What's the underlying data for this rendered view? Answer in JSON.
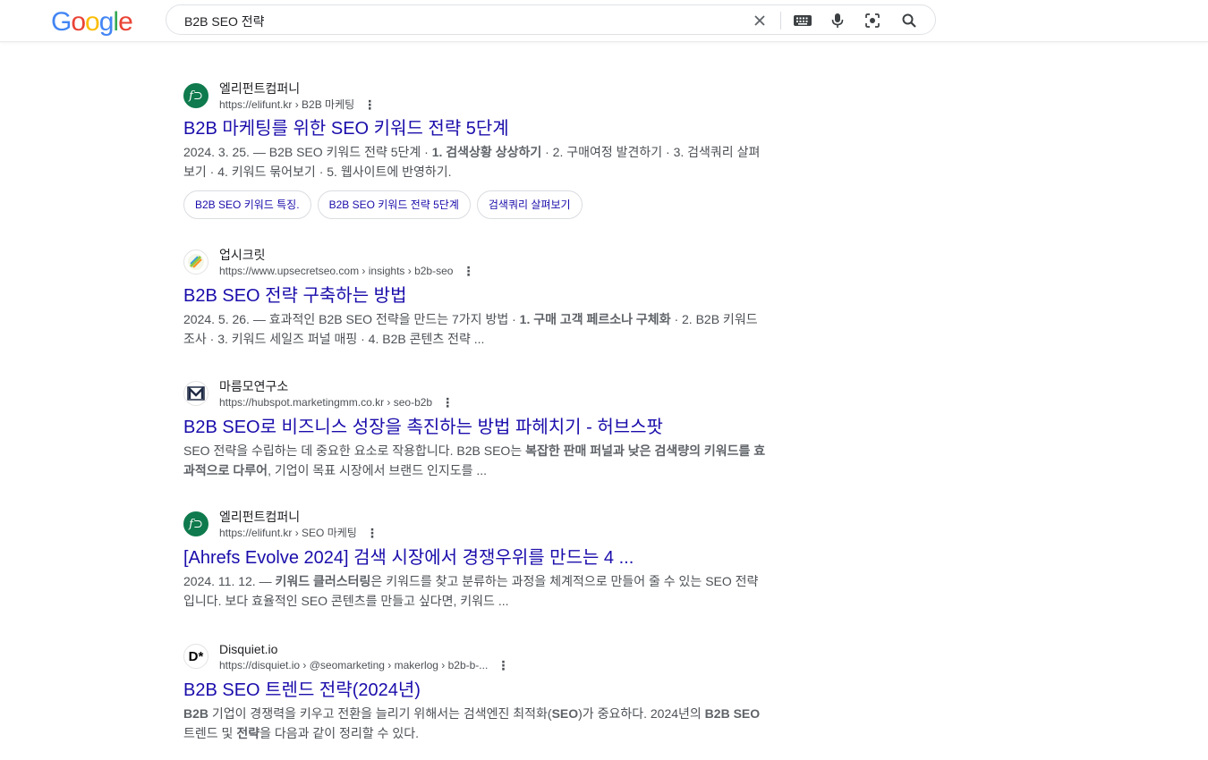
{
  "header": {
    "logo_letters": [
      "G",
      "o",
      "o",
      "g",
      "l",
      "e"
    ],
    "logo_colors": [
      "#4285F4",
      "#EA4335",
      "#FBBC05",
      "#4285F4",
      "#34A853",
      "#EA4335"
    ],
    "search_query": "B2B SEO 전략",
    "icons": [
      "close-icon",
      "keyboard-icon",
      "microphone-icon",
      "lens-icon",
      "search-icon"
    ]
  },
  "results": [
    {
      "site_name": "엘리펀트컴퍼니",
      "url": "https://elifunt.kr › B2B 마케팅",
      "favicon_text": "f⊃",
      "favicon_bg": "#0f7a4d",
      "title": "B2B 마케팅를 위한 SEO 키워드 전략 5단계",
      "snippet_parts": [
        {
          "t": "2024. 3. 25. — B2B SEO 키워드 전략 5단계 · ",
          "b": false
        },
        {
          "t": "1. 검색상황 상상하기",
          "b": true
        },
        {
          "t": " · 2. 구매여정 발견하기 · 3. 검색쿼리 살펴보기 · 4. 키워드 묶어보기 · 5. 웹사이트에 반영하기.",
          "b": false
        }
      ],
      "chips": [
        "B2B SEO 키워드 특징.",
        "B2B SEO 키워드 전략 5단계",
        "검색쿼리 살펴보기"
      ]
    },
    {
      "site_name": "업시크릿",
      "url": "https://www.upsecretseo.com › insights › b2b-seo",
      "favicon_text": "⟋",
      "favicon_bg": "#ffffff",
      "title": "B2B SEO 전략 구축하는 방법",
      "snippet_parts": [
        {
          "t": "2024. 5. 26. — 효과적인 B2B SEO 전략을 만드는 7가지 방법 · ",
          "b": false
        },
        {
          "t": "1. 구매 고객 페르소나 구체화",
          "b": true
        },
        {
          "t": " · 2. B2B 키워드 조사 · 3. 키워드 세일즈 퍼널 매핑 · 4. B2B 콘텐츠 전략 ...",
          "b": false
        }
      ],
      "chips": []
    },
    {
      "site_name": "마름모연구소",
      "url": "https://hubspot.marketingmm.co.kr › seo-b2b",
      "favicon_text": "M",
      "favicon_bg": "#ffffff",
      "title": "B2B SEO로 비즈니스 성장을 촉진하는 방법 파헤치기 - 허브스팟",
      "snippet_parts": [
        {
          "t": "SEO 전략을 수립하는 데 중요한 요소로 작용합니다. B2B SEO는 ",
          "b": false
        },
        {
          "t": "복잡한 판매 퍼널과 낮은 검색량의 키워드를 효과적으로 다루어",
          "b": true
        },
        {
          "t": ", 기업이 목표 시장에서 브랜드 인지도를 ...",
          "b": false
        }
      ],
      "chips": []
    },
    {
      "site_name": "엘리펀트컴퍼니",
      "url": "https://elifunt.kr › SEO 마케팅",
      "favicon_text": "f⊃",
      "favicon_bg": "#0f7a4d",
      "title": "[Ahrefs Evolve 2024] 검색 시장에서 경쟁우위를 만드는 4 ...",
      "snippet_parts": [
        {
          "t": "2024. 11. 12. — ",
          "b": false
        },
        {
          "t": "키워드 클러스터링",
          "b": true
        },
        {
          "t": "은 키워드를 찾고 분류하는 과정을 체계적으로 만들어 줄 수 있는 SEO 전략입니다. 보다 효율적인 SEO 콘텐츠를 만들고 싶다면, 키워드 ...",
          "b": false
        }
      ],
      "chips": []
    },
    {
      "site_name": "Disquiet.io",
      "url": "https://disquiet.io › @seomarketing › makerlog › b2b-b-...",
      "favicon_text": "D*",
      "favicon_bg": "#ffffff",
      "title": "B2B SEO 트렌드 전략(2024년)",
      "snippet_parts": [
        {
          "t": "B2B",
          "b": true
        },
        {
          "t": " 기업이 경쟁력을 키우고 전환을 늘리기 위해서는 검색엔진 최적화(",
          "b": false
        },
        {
          "t": "SEO",
          "b": true
        },
        {
          "t": ")가 중요하다. 2024년의 ",
          "b": false
        },
        {
          "t": "B2B SEO",
          "b": true
        },
        {
          "t": " 트렌드 및 ",
          "b": false
        },
        {
          "t": "전략",
          "b": true
        },
        {
          "t": "을 다음과 같이 정리할 수 있다.",
          "b": false
        }
      ],
      "chips": []
    }
  ]
}
